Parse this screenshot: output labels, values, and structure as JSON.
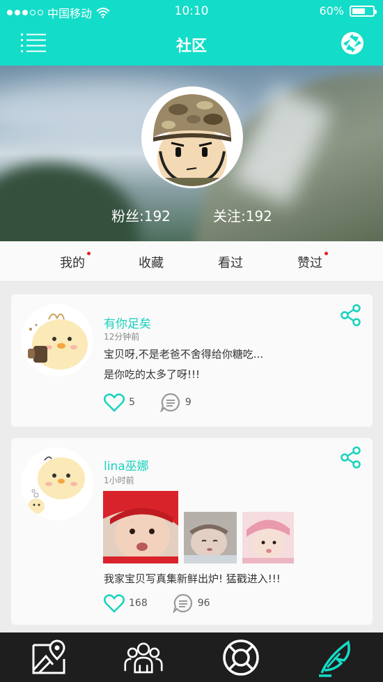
{
  "status_bar": {
    "carrier": "中国移动",
    "time": "10:10",
    "battery": "60%",
    "battery_level": 0.6
  },
  "nav": {
    "title": "社区",
    "menu_icon": "menu-icon",
    "camera_icon": "camera-shutter-icon"
  },
  "profile": {
    "fans": "粉丝:192",
    "following": "关注:192"
  },
  "tabs": [
    {
      "label": "我的",
      "dot": true
    },
    {
      "label": "收藏",
      "dot": false
    },
    {
      "label": "看过",
      "dot": false
    },
    {
      "label": "赞过",
      "dot": true
    }
  ],
  "posts": [
    {
      "name": "有你足矣",
      "time": "12分钟前",
      "lines": [
        "宝贝呀,不是老爸不舍得给你糖吃...",
        "是你吃的太多了呀!!!"
      ],
      "likes": "5",
      "comments": "9"
    },
    {
      "name": "lina巫娜",
      "time": "1小时前",
      "lines": [
        "我家宝贝写真集新鲜出炉!  猛戳进入!!!"
      ],
      "likes": "168",
      "comments": "96"
    }
  ],
  "tabbar": [
    "map-icon",
    "community-group-icon",
    "lifebuoy-icon",
    "feather-icon"
  ],
  "colors": {
    "accent": "#13dcc8",
    "tabbar": "#1e1e1e",
    "reddot": "#e51e1e"
  }
}
